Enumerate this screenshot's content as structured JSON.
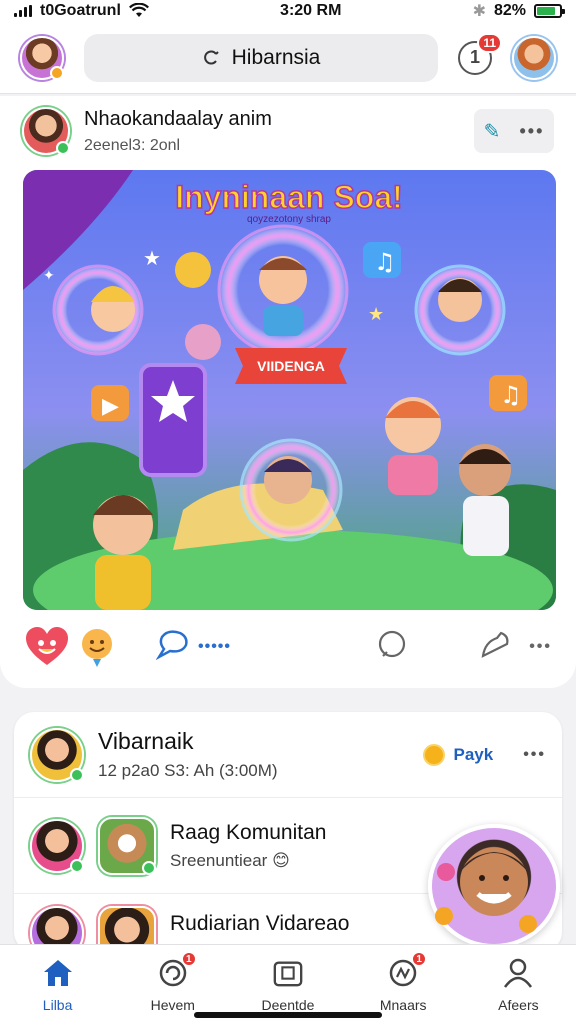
{
  "status_bar": {
    "carrier": "t0Goatrunl",
    "time": "3:20 RM",
    "battery": "82%",
    "battery_level": 0.82
  },
  "header": {
    "search_text": "Hibarnsia",
    "notification_count": "11",
    "notification_glyph": "1"
  },
  "post": {
    "author": "Nhaokandaalay anim",
    "time": "2eenel3: 2onl",
    "image": {
      "title": "Inyninaan Soa!",
      "subtitle": "qoyzezotony shrap",
      "banner": "VIIDENGA"
    }
  },
  "feed": {
    "items": [
      {
        "title": "Vibarnaik",
        "subtitle": "12 p2a0 S3: Ah (3:00M)",
        "action_label": "Payk"
      },
      {
        "title": "Raag Komunitan",
        "subtitle": "Sreenuntiear 😊"
      },
      {
        "title": "Rudiarian Vidareao",
        "subtitle": ""
      }
    ]
  },
  "nav": {
    "items": [
      {
        "label": "Lilba",
        "icon": "home-icon",
        "badge": ""
      },
      {
        "label": "Hevem",
        "icon": "refresh-icon",
        "badge": "1"
      },
      {
        "label": "Deentde",
        "icon": "camera-icon",
        "badge": ""
      },
      {
        "label": "Mnaars",
        "icon": "activity-icon",
        "badge": "1"
      },
      {
        "label": "Afeers",
        "icon": "profile-icon",
        "badge": ""
      }
    ]
  },
  "colors": {
    "accent": "#1f5fbf",
    "badge": "#e53935",
    "online": "#3cc15a"
  }
}
